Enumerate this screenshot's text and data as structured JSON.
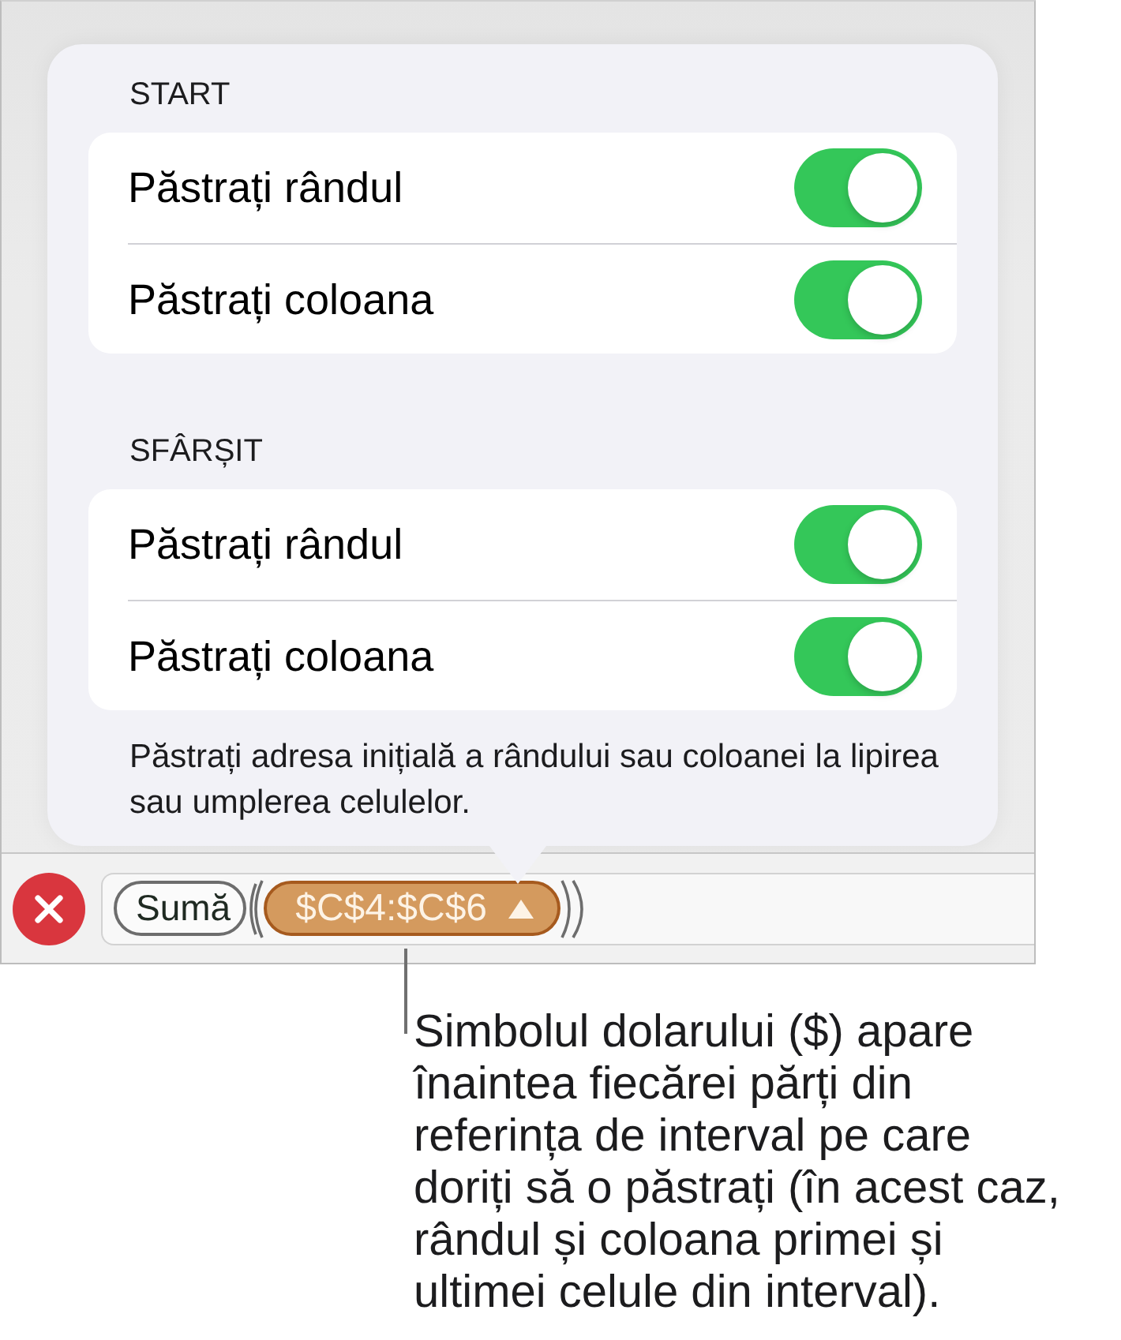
{
  "popover": {
    "sections": [
      {
        "header": "START",
        "rows": [
          {
            "label": "Păstrați rândul",
            "on": true
          },
          {
            "label": "Păstrați coloana",
            "on": true
          }
        ]
      },
      {
        "header": "SFÂRȘIT",
        "rows": [
          {
            "label": "Păstrați rândul",
            "on": true
          },
          {
            "label": "Păstrați coloana",
            "on": true
          }
        ]
      }
    ],
    "note": "Păstrați adresa inițială a rândului sau coloanei la lipirea sau umplerea celulelor."
  },
  "formula_bar": {
    "tokens": [
      {
        "kind": "function",
        "text": "Sumă",
        "selected": false
      },
      {
        "kind": "range",
        "text": "$C$4:$C$6",
        "selected": true
      }
    ]
  },
  "callout": {
    "text": "Simbolul dolarului ($) apare\nînaintea fiecărei părți din\nreferința de interval pe care\ndoriți să o păstrați (în acest caz,\nrândul și coloana primei și\nultimei celule din interval)."
  }
}
